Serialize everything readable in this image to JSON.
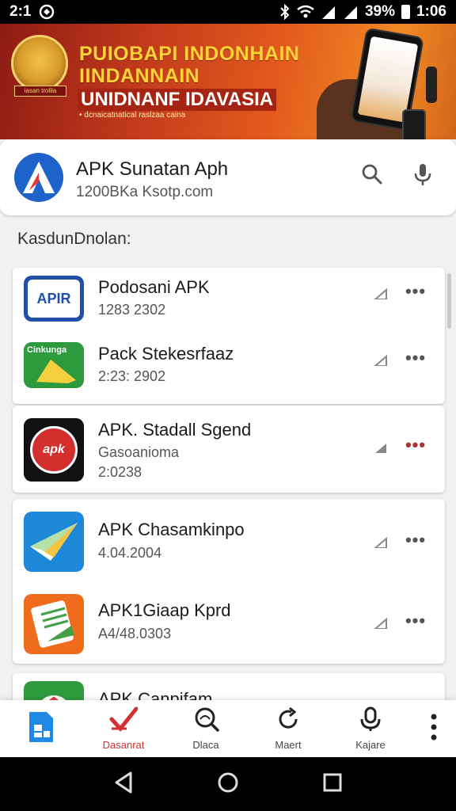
{
  "status_bar": {
    "time_left": "2:1",
    "battery": "39%",
    "clock": "1:06"
  },
  "banner": {
    "line1": "PUIOBAPI INDONHAIN",
    "line2": "IINDANNAIN",
    "line3": "UNIDNANF IDAVASIA",
    "line4": "• dcnaicatnatical raslzaa caina",
    "emblem_text": "iasan trolila"
  },
  "search": {
    "title": "APK Sunatan Aph",
    "subtitle": "1200BKa Ksotp.com"
  },
  "section": {
    "title": "KasdunDnolan:"
  },
  "apps": [
    {
      "name": "Podosani APK",
      "meta": "1283 2302",
      "icon_label": "APIR",
      "icon": "apk-blue-icon"
    },
    {
      "name": "Pack Stekesrfaaz",
      "meta": "2:23: 2902",
      "icon_label": "Cinkunga",
      "icon": "green-ruler-icon"
    },
    {
      "name": "APK. Stadall Sgend",
      "meta": "Gasoanioma",
      "meta2": "2:0238",
      "icon_label": "apk",
      "icon": "red-circle-icon"
    },
    {
      "name": "APK Chasamkinpo",
      "meta": "4.04.2004",
      "icon_label": "",
      "icon": "paper-plane-icon"
    },
    {
      "name": "APK1Giaap Kprd",
      "meta": "A4/48.0303",
      "icon_label": "",
      "icon": "notebook-icon"
    },
    {
      "name": "APK Canpifam",
      "meta": "",
      "icon_label": "",
      "icon": "green-app-icon"
    }
  ],
  "tabs": [
    {
      "label": "",
      "icon": "document-icon"
    },
    {
      "label": "Dasanrat",
      "icon": "checkmark-icon"
    },
    {
      "label": "Dlaca",
      "icon": "search-icon"
    },
    {
      "label": "Maert",
      "icon": "refresh-icon"
    },
    {
      "label": "Kajare",
      "icon": "microphone-icon"
    },
    {
      "label": "",
      "icon": "more-vertical-icon"
    }
  ],
  "colors": {
    "accent_red": "#d32f2f",
    "brand_blue": "#1e63c9",
    "banner_orange": "#e25a1c"
  }
}
